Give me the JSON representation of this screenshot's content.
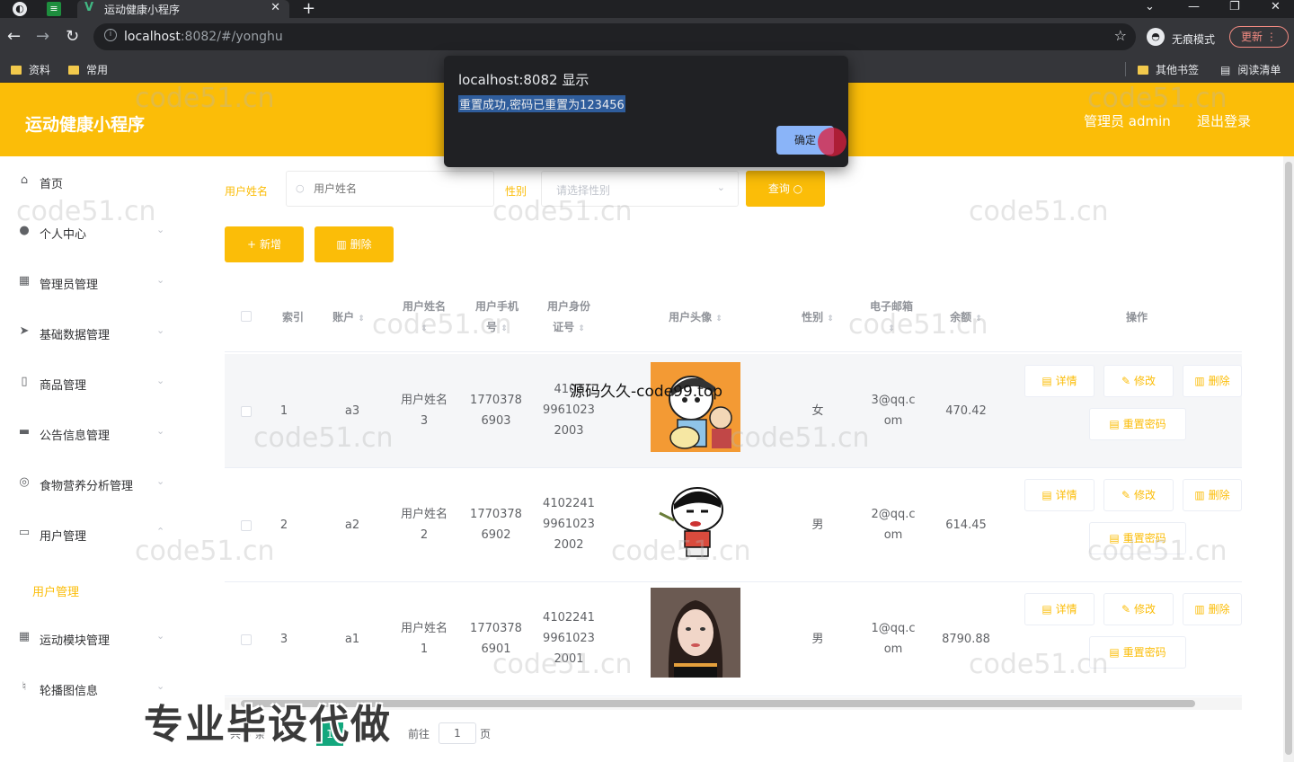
{
  "browser": {
    "tab_title": "运动健康小程序",
    "url_host": "localhost",
    "url_path": ":8082/#/yonghu",
    "incognito_label": "无痕模式",
    "update_label": "更新",
    "bookmarks": [
      "资料",
      "常用"
    ],
    "bookmarks_right": [
      "其他书签",
      "阅读清单"
    ]
  },
  "dialog": {
    "title": "localhost:8082 显示",
    "message": "重置成功,密码已重置为123456",
    "ok_label": "确定"
  },
  "header": {
    "title": "运动健康小程序",
    "admin_label": "管理员 admin",
    "logout_label": "退出登录"
  },
  "sidebar": {
    "items": [
      {
        "label": "首页",
        "icon": "home-icon"
      },
      {
        "label": "个人中心",
        "icon": "user-icon"
      },
      {
        "label": "管理员管理",
        "icon": "grid-icon"
      },
      {
        "label": "基础数据管理",
        "icon": "send-icon"
      },
      {
        "label": "商品管理",
        "icon": "goods-icon"
      },
      {
        "label": "公告信息管理",
        "icon": "briefcase-icon"
      },
      {
        "label": "食物营养分析管理",
        "icon": "compass-icon"
      },
      {
        "label": "用户管理",
        "icon": "card-icon"
      },
      {
        "label": "运动模块管理",
        "icon": "grid-icon"
      },
      {
        "label": "轮播图信息",
        "icon": "mic-icon"
      }
    ],
    "active_sub": "用户管理"
  },
  "search": {
    "name_label": "用户姓名",
    "name_placeholder": "用户姓名",
    "gender_label": "性别",
    "gender_placeholder": "请选择性别",
    "query_label": "查询"
  },
  "actions": {
    "add_label": "新增",
    "delete_label": "删除"
  },
  "table": {
    "headers": {
      "index": "索引",
      "account": "账户",
      "name_1": "用户姓名",
      "phone_1": "用户手机",
      "phone_2": "号",
      "idcard_1": "用户身份",
      "idcard_2": "证号",
      "avatar": "用户头像",
      "gender": "性别",
      "email": "电子邮箱",
      "balance": "余额",
      "ops": "操作"
    },
    "rows": [
      {
        "index": "1",
        "account": "a3",
        "name_1": "用户姓名",
        "name_2": "3",
        "phone_1": "1770378",
        "phone_2": "6903",
        "id_1": "4102",
        "id_2": "9961023",
        "id_3": "2003",
        "gender": "女",
        "email_1": "3@qq.c",
        "email_2": "om",
        "balance": "470.42"
      },
      {
        "index": "2",
        "account": "a2",
        "name_1": "用户姓名",
        "name_2": "2",
        "phone_1": "1770378",
        "phone_2": "6902",
        "id_1": "4102241",
        "id_2": "9961023",
        "id_3": "2002",
        "gender": "男",
        "email_1": "2@qq.c",
        "email_2": "om",
        "balance": "614.45"
      },
      {
        "index": "3",
        "account": "a1",
        "name_1": "用户姓名",
        "name_2": "1",
        "phone_1": "1770378",
        "phone_2": "6901",
        "id_1": "4102241",
        "id_2": "9961023",
        "id_3": "2001",
        "gender": "男",
        "email_1": "1@qq.c",
        "email_2": "om",
        "balance": "8790.88"
      }
    ],
    "op_labels": {
      "detail": "详情",
      "edit": "修改",
      "delete": "删除",
      "reset": "重置密码"
    }
  },
  "pager": {
    "total": "共 3 条",
    "current": "1",
    "goto": "前往",
    "page_input": "1",
    "page_unit": "页"
  },
  "overlays": {
    "big_text": "专业毕设代做",
    "mid_text": "源码久久-code99.top",
    "watermark": "code51.cn"
  },
  "colors": {
    "accent": "#fbbd08",
    "chrome": "#35363a"
  }
}
